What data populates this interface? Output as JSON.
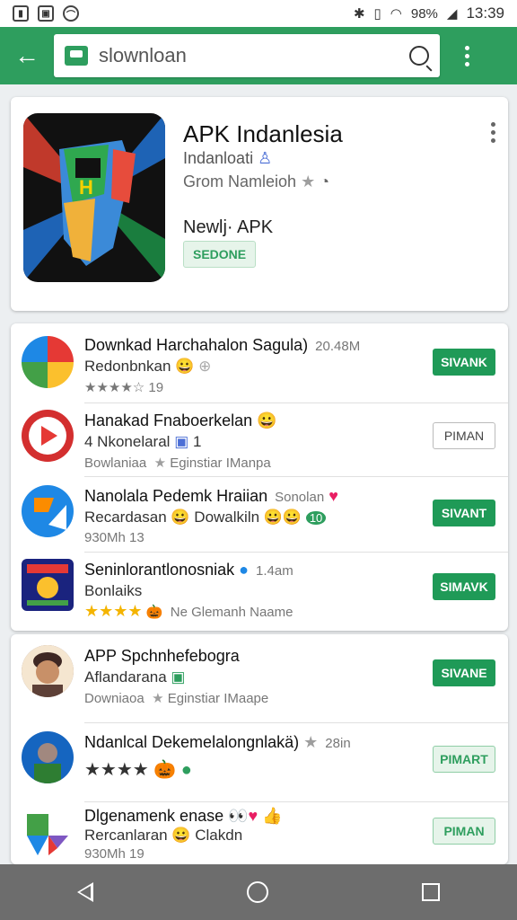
{
  "status_bar": {
    "battery": "98%",
    "time": "13:39"
  },
  "search": {
    "value": "slownloan"
  },
  "featured": {
    "title": "APK Indanlesia",
    "developer": "Indanloati",
    "meta": "Grom Namleioh",
    "subtitle": "Newlj· APK",
    "badge": "SEDONE"
  },
  "list1": [
    {
      "title": "Downkad Harchahalon Sagula)",
      "size": "20.48M",
      "line2": "Redonbnkan",
      "line3": "★★★★☆ 19",
      "button": "SIVANK",
      "button_style": "solid"
    },
    {
      "title": "Hanakad Fnaboerkelan",
      "line2": "4 Nkonelaral",
      "line2b": "1",
      "line3": "Bowlaniaa",
      "line3b": "Eginstiar IManpa",
      "button": "PIMAN",
      "button_style": "outline"
    },
    {
      "title": "Nanolala Pedemk Hraiian",
      "size": "Sonolan",
      "line2": "Recardasan",
      "line2b": "Dowalkiln",
      "line3": "930Mh 13",
      "button": "SIVANT",
      "button_style": "solid"
    },
    {
      "title": "Seninlorantlonosniak",
      "size": "1.4am",
      "line2": "Bonlaiks",
      "line3": "★★★★",
      "line3b": "Ne Glemanh Naame",
      "button": "SIMAVK",
      "button_style": "solid"
    }
  ],
  "list2": [
    {
      "title": "APP Spchnhefebogra",
      "line2": "Aflandarana",
      "line3": "Downiaoa",
      "line3b": "Eginstiar IMaape",
      "button": "SIVANE",
      "button_style": "solid"
    },
    {
      "title": "Ndanlcal Dekemelalongnlakä)",
      "size": "28in",
      "line2": "★★★★",
      "button": "PIMART",
      "button_style": "light"
    },
    {
      "title": "Dlgenamenk enase",
      "line2": "Rercanlaran",
      "line2b": "Clakdn",
      "line3": "930Mh 19",
      "button": "PIMAN",
      "button_style": "light"
    }
  ]
}
